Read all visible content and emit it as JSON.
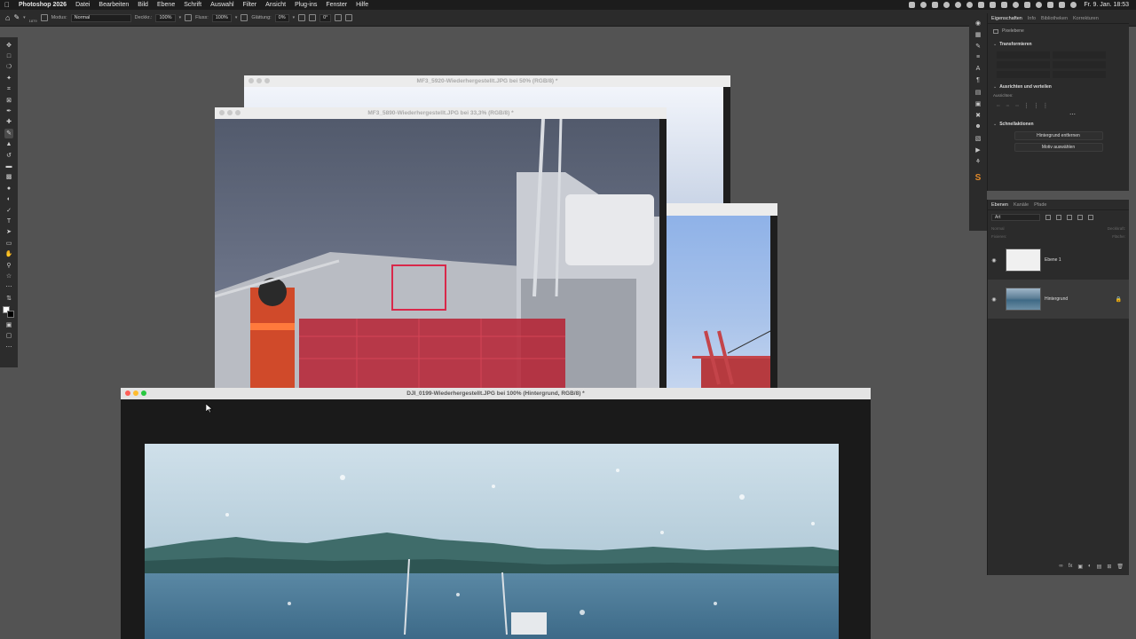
{
  "menubar": {
    "app": "Photoshop 2026",
    "items": [
      "Datei",
      "Bearbeiten",
      "Bild",
      "Ebene",
      "Schrift",
      "Auswahl",
      "Filter",
      "Ansicht",
      "Plug-ins",
      "Fenster",
      "Hilfe"
    ],
    "clock": "Fr. 9. Jan. 18:53"
  },
  "options": {
    "brush_size": "1879",
    "mode_label": "Modus:",
    "mode_value": "Normal",
    "opacity_label": "Deckkr.:",
    "opacity_value": "100%",
    "flow_label": "Fluss:",
    "flow_value": "100%",
    "smoothing_label": "Glättung:",
    "smoothing_value": "0%",
    "angle_value": "0°"
  },
  "documents": {
    "back": {
      "title": "MF3_5920-Wiederhergestellt.JPG bei 50% (RGB/8) *"
    },
    "middle": {
      "title": "MF3_5890-Wiederhergestellt.JPG bei 33,3% (RGB/8) *"
    },
    "front": {
      "title": "DJI_0199-Wiederhergestellt.JPG bei 100% (Hintergrund, RGB/8) *"
    }
  },
  "properties": {
    "tabs": [
      "Eigenschaften",
      "Info",
      "Bibliotheken",
      "Korrekturen"
    ],
    "pixel_layer": "Pixelebene",
    "transform_title": "Transformieren",
    "align_title": "Ausrichten und verteilen",
    "align_label": "Ausrichten:",
    "quick_title": "Schnellaktionen",
    "btn_remove_bg": "Hintergrund entfernen",
    "btn_select_subject": "Motiv auswählen"
  },
  "layers": {
    "tabs": [
      "Ebenen",
      "Kanäle",
      "Pfade"
    ],
    "filter_kind": "Art",
    "blend": "Normal",
    "opacity": "Deckkraft:",
    "lock": "Fixieren:",
    "fill": "Fläche:",
    "items": [
      {
        "name": "Ebene 1"
      },
      {
        "name": "Hintergrund"
      }
    ]
  },
  "colors": {
    "accent_red": "#ff5f57",
    "accent_yellow": "#febc2e",
    "accent_green": "#28c840",
    "workspace": "#535353"
  }
}
